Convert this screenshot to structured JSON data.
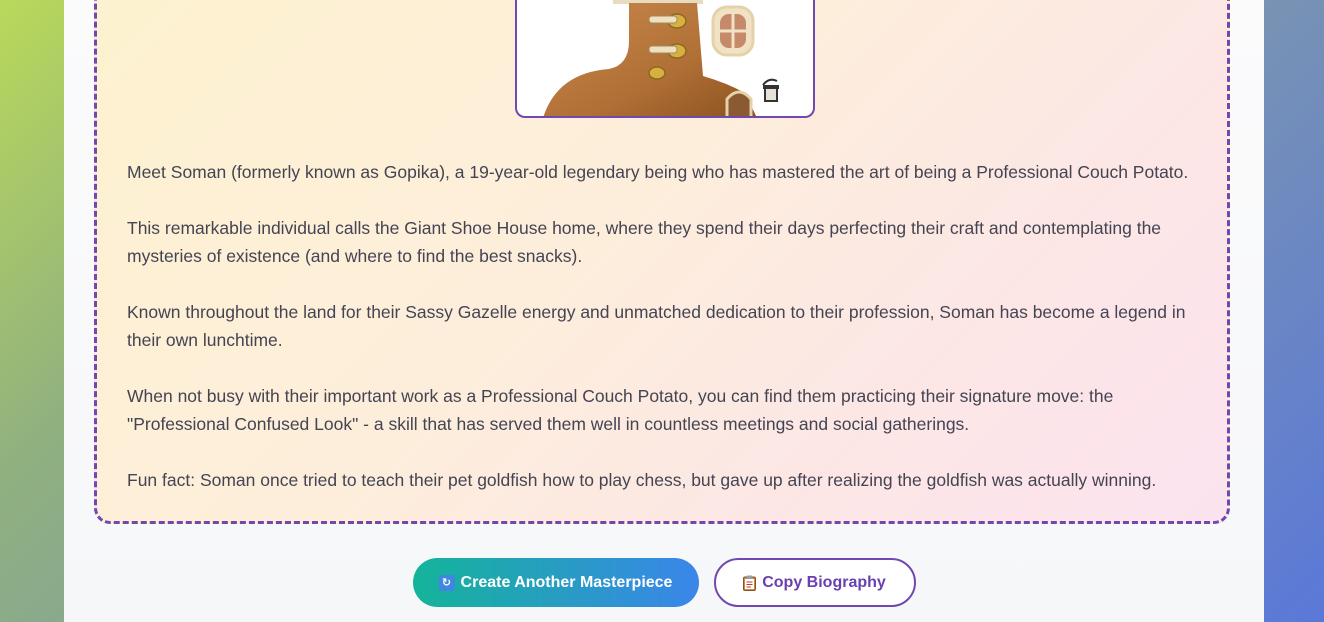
{
  "biography": {
    "paragraphs": [
      "Meet Soman (formerly known as Gopika), a 19-year-old legendary being who has mastered the art of being a Professional Couch Potato.",
      "This remarkable individual calls the Giant Shoe House home, where they spend their days perfecting their craft and contemplating the mysteries of existence (and where to find the best snacks).",
      "Known throughout the land for their Sassy Gazelle energy and unmatched dedication to their profession, Soman has become a legend in their own lunchtime.",
      "When not busy with their important work as a Professional Couch Potato, you can find them practicing their signature move: the \"Professional Confused Look\" - a skill that has served them well in countless meetings and social gatherings.",
      "Fun fact: Soman once tried to teach their pet goldfish how to play chess, but gave up after realizing the goldfish was actually winning."
    ],
    "image_icon": "giant-shoe-house-illustration"
  },
  "actions": {
    "create_label": "Create Another Masterpiece",
    "create_icon": "refresh-icon",
    "copy_label": "Copy Biography",
    "copy_icon": "clipboard-icon"
  },
  "colors": {
    "accent": "#7048b0",
    "primary_gradient_start": "#14b49a",
    "primary_gradient_end": "#3a86ea",
    "text": "#444452"
  }
}
